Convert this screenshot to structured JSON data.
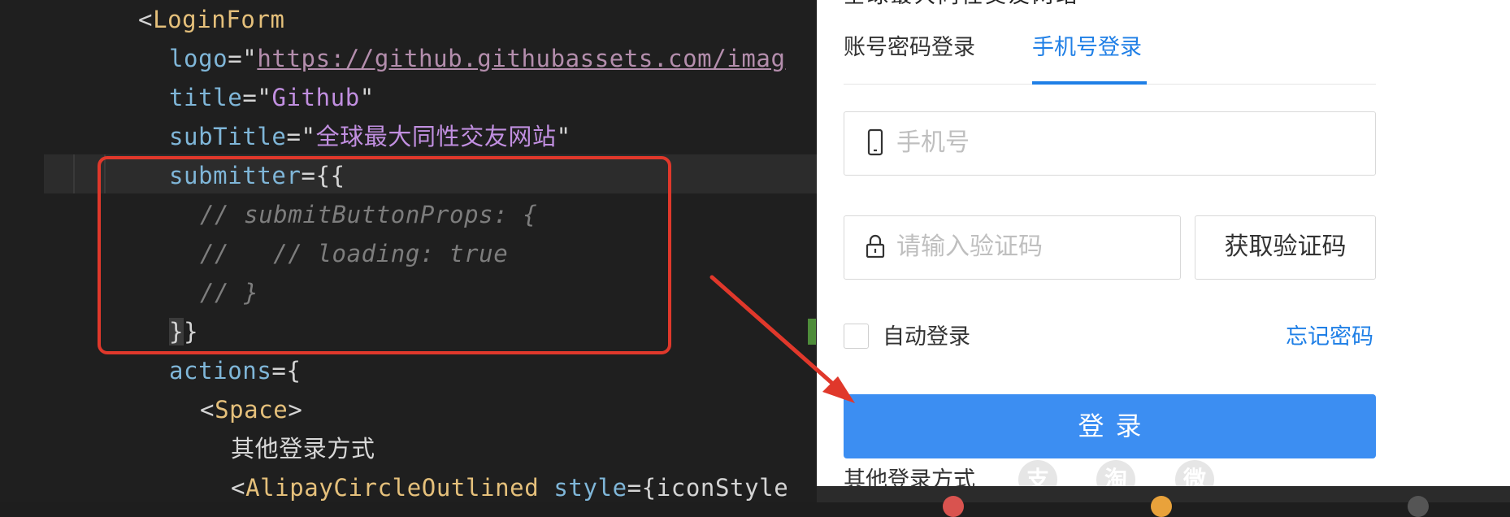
{
  "editor": {
    "lines": [
      {
        "id": "l1",
        "parts": [
          {
            "t": "<",
            "c": "punc"
          },
          {
            "t": "LoginForm",
            "c": "tag"
          }
        ]
      },
      {
        "id": "l2",
        "parts": [
          {
            "t": "logo",
            "c": "attr"
          },
          {
            "t": "=\"",
            "c": "strq"
          },
          {
            "t": "https://github.githubassets.com/imag",
            "c": "url"
          }
        ]
      },
      {
        "id": "l3",
        "parts": [
          {
            "t": "title",
            "c": "attr"
          },
          {
            "t": "=\"",
            "c": "strq"
          },
          {
            "t": "Github",
            "c": "purple"
          },
          {
            "t": "\"",
            "c": "strq"
          }
        ]
      },
      {
        "id": "l4",
        "parts": [
          {
            "t": "subTitle",
            "c": "attr"
          },
          {
            "t": "=\"",
            "c": "strq"
          },
          {
            "t": "全球最大同性交友网站",
            "c": "purple"
          },
          {
            "t": "\"",
            "c": "strq"
          }
        ]
      },
      {
        "id": "l5",
        "parts": [
          {
            "t": "submitter",
            "c": "attr"
          },
          {
            "t": "={{",
            "c": "punc"
          }
        ]
      },
      {
        "id": "l6",
        "parts": [
          {
            "t": "// submitButtonProps: {",
            "c": "cmt"
          }
        ]
      },
      {
        "id": "l7",
        "parts": [
          {
            "t": "//   // loading: true",
            "c": "cmt"
          }
        ]
      },
      {
        "id": "l8",
        "parts": [
          {
            "t": "// }",
            "c": "cmt"
          }
        ]
      },
      {
        "id": "l9",
        "parts": [
          {
            "t": "}",
            "c": "punc brace-hl"
          },
          {
            "t": "}",
            "c": "punc"
          }
        ]
      },
      {
        "id": "l10",
        "parts": [
          {
            "t": "actions",
            "c": "attr"
          },
          {
            "t": "={",
            "c": "punc"
          }
        ]
      },
      {
        "id": "l11",
        "parts": [
          {
            "t": "<",
            "c": "punc"
          },
          {
            "t": "Space",
            "c": "tag"
          },
          {
            "t": ">",
            "c": "punc"
          }
        ]
      },
      {
        "id": "l12",
        "parts": [
          {
            "t": "其他登录方式",
            "c": "plain"
          }
        ]
      },
      {
        "id": "l13",
        "parts": [
          {
            "t": "<",
            "c": "punc"
          },
          {
            "t": "AlipayCircleOutlined",
            "c": "tag"
          },
          {
            "t": " style",
            "c": "attr"
          },
          {
            "t": "={iconStyle",
            "c": "punc"
          }
        ]
      }
    ]
  },
  "login": {
    "cut_title": "全球最大同性交友网站",
    "tabs": [
      {
        "label": "账号密码登录",
        "active": false
      },
      {
        "label": "手机号登录",
        "active": true
      }
    ],
    "phone_placeholder": "手机号",
    "code_placeholder": "请输入验证码",
    "get_code_label": "获取验证码",
    "auto_login_label": "自动登录",
    "forgot_label": "忘记密码",
    "login_button": "登录",
    "other_methods_label": "其他登录方式",
    "social_icons": [
      {
        "name": "alipay-icon",
        "glyph": "支"
      },
      {
        "name": "taobao-icon",
        "glyph": "淘"
      },
      {
        "name": "weibo-icon",
        "glyph": "微"
      }
    ]
  },
  "colors": {
    "accent": "#1f7fe6",
    "button": "#3c8ef2",
    "annotation": "#e0382b"
  }
}
